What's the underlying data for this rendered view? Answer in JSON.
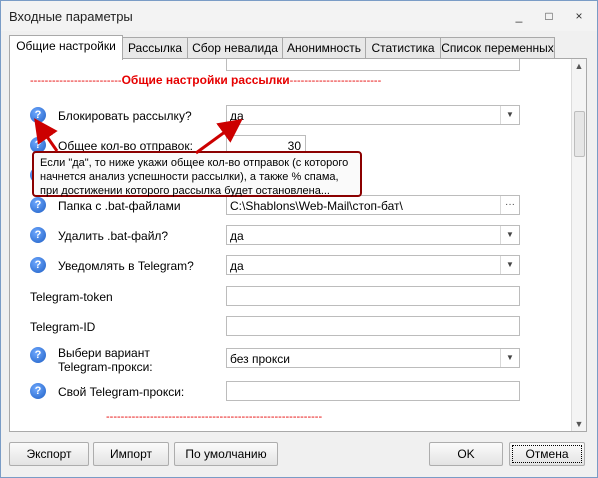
{
  "window": {
    "title": "Входные параметры",
    "controls": [
      "_",
      "□",
      "×"
    ]
  },
  "tabs": [
    "Общие настройки",
    "Рассылка",
    "Сбор невалида",
    "Анонимность",
    "Статистика",
    "Список переменных"
  ],
  "section_top": {
    "prefix": "-------------------------",
    "title": "Общие настройки рассылки",
    "suffix": "-------------------------"
  },
  "rows": {
    "block": {
      "label": "Блокировать рассылку?",
      "value": "да"
    },
    "count": {
      "label": "Общее кол-во отправок:",
      "value": "30"
    },
    "folder": {
      "label": "Папка с .bat-файлами",
      "value": "C:\\Shablons\\Web-Mail\\стоп-бат\\",
      "browse": "···"
    },
    "delete": {
      "label": "Удалить .bat-файл?",
      "value": "да"
    },
    "notify": {
      "label": "Уведомлять в Telegram?",
      "value": "да"
    },
    "token": {
      "label": "Telegram-token",
      "value": ""
    },
    "tgid": {
      "label": "Telegram-ID",
      "value": ""
    },
    "proxy_variant": {
      "label_1": "Выбери вариант",
      "label_2": "Telegram-прокси:",
      "value": "без прокси"
    },
    "own_proxy": {
      "label": "Свой Telegram-прокси:",
      "value": ""
    }
  },
  "section_bottom": {
    "line": "-----------------------------------------------------------"
  },
  "tooltip": {
    "line1": "Если \"да\", то ниже укажи общее кол-во отправок (с которого",
    "line2": "начнется анализ успешности рассылки), а также % спама,",
    "line3": "при достижении которого рассылка будет остановлена..."
  },
  "footer": {
    "export": "Экспорт",
    "import": "Импорт",
    "default": "По умолчанию",
    "ok": "OK",
    "cancel": "Отмена"
  },
  "colors": {
    "section_red": "#e60000",
    "arrow_red": "#cc0000",
    "tooltip_border": "#8b0000"
  },
  "icons": {
    "help": "?",
    "dropdown": "▼",
    "scroll_up": "▲",
    "scroll_down": "▼"
  }
}
